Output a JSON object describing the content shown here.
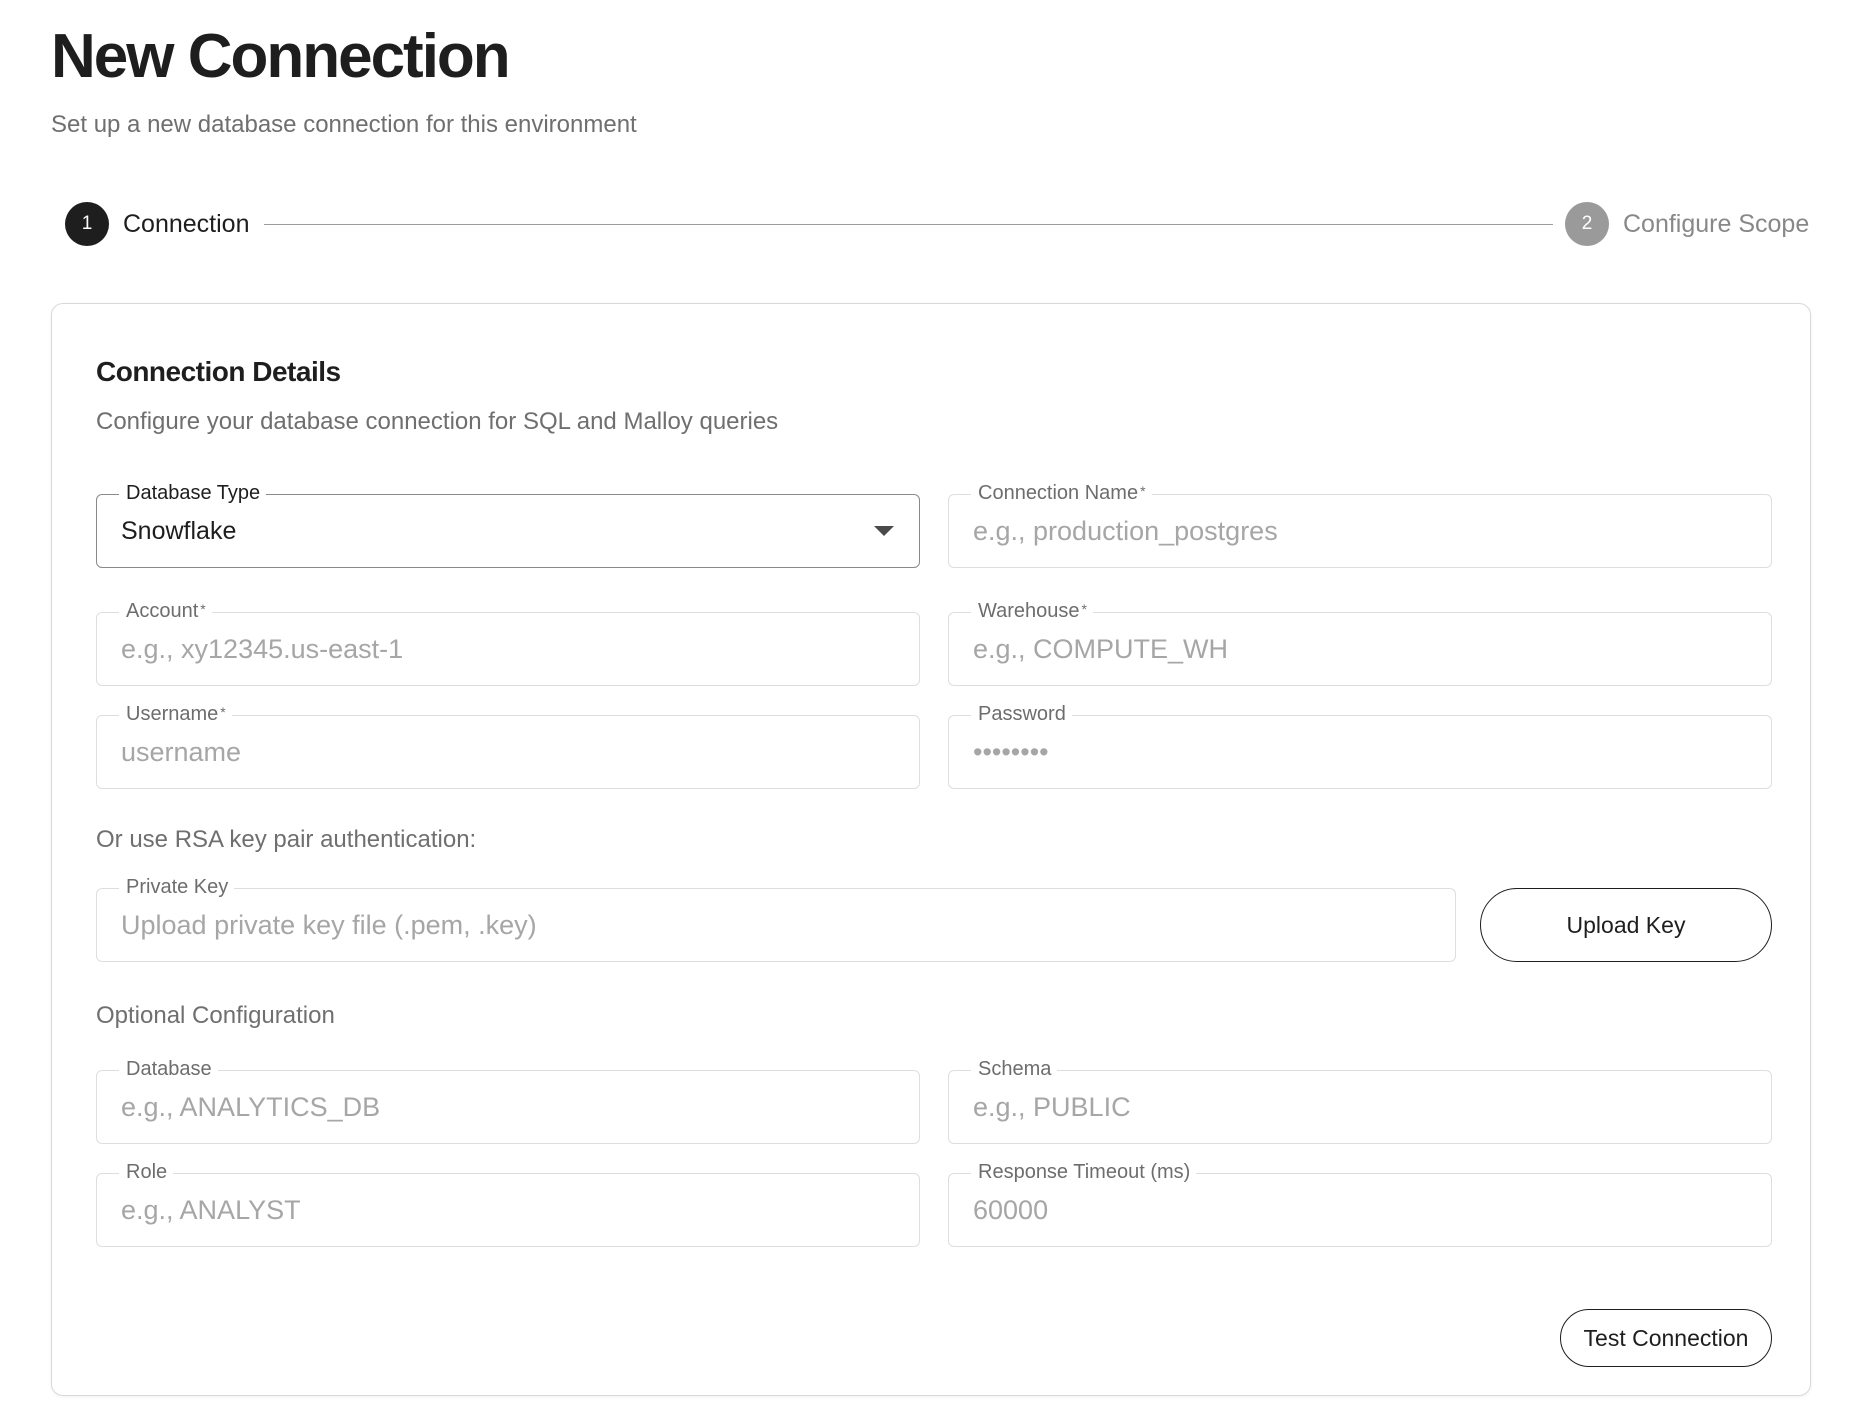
{
  "header": {
    "title": "New Connection",
    "subtitle": "Set up a new database connection for this environment"
  },
  "stepper": {
    "steps": [
      {
        "number": "1",
        "label": "Connection",
        "active": true
      },
      {
        "number": "2",
        "label": "Configure Scope",
        "active": false
      }
    ]
  },
  "card": {
    "title": "Connection Details",
    "subtitle": "Configure your database connection for SQL and Malloy queries",
    "fields": {
      "database_type": {
        "label": "Database Type",
        "value": "Snowflake"
      },
      "connection_name": {
        "label": "Connection Name",
        "required_mark": "*",
        "value": "",
        "placeholder": "e.g., production_postgres"
      },
      "account": {
        "label": "Account",
        "required_mark": "*",
        "value": "",
        "placeholder": "e.g., xy12345.us-east-1"
      },
      "warehouse": {
        "label": "Warehouse",
        "required_mark": "*",
        "value": "",
        "placeholder": "e.g., COMPUTE_WH"
      },
      "username": {
        "label": "Username",
        "required_mark": "*",
        "value": "",
        "placeholder": "username"
      },
      "password": {
        "label": "Password",
        "value": "",
        "placeholder": "••••••••"
      }
    },
    "rsa": {
      "heading": "Or use RSA key pair authentication:",
      "private_key": {
        "label": "Private Key",
        "value": "",
        "placeholder": "Upload private key file (.pem, .key)"
      },
      "upload_button": "Upload Key"
    },
    "optional": {
      "heading": "Optional Configuration",
      "database": {
        "label": "Database",
        "value": "",
        "placeholder": "e.g., ANALYTICS_DB"
      },
      "schema": {
        "label": "Schema",
        "value": "",
        "placeholder": "e.g., PUBLIC"
      },
      "role": {
        "label": "Role",
        "value": "",
        "placeholder": "e.g., ANALYST"
      },
      "response_timeout": {
        "label": "Response Timeout (ms)",
        "value": "",
        "placeholder": "60000"
      }
    },
    "test_button": "Test Connection"
  },
  "colors": {
    "text_primary": "#1e1e1e",
    "text_secondary": "#6f6f6f",
    "placeholder": "#a6a6a6",
    "step_inactive": "#9a9a9a",
    "border": "#dedede"
  }
}
